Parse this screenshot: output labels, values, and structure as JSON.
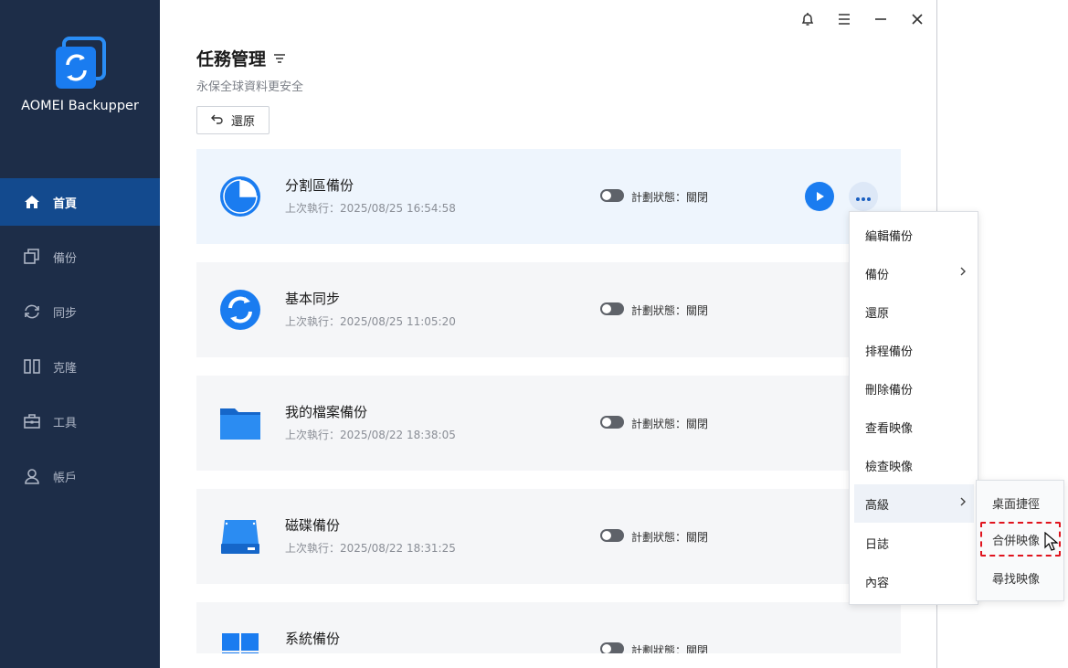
{
  "app": {
    "name": "AOMEI Backupper"
  },
  "sidebar": {
    "items": [
      {
        "label": "首頁",
        "icon": "home-icon",
        "active": true
      },
      {
        "label": "備份",
        "icon": "backup-icon",
        "active": false
      },
      {
        "label": "同步",
        "icon": "sync-icon",
        "active": false
      },
      {
        "label": "克隆",
        "icon": "clone-icon",
        "active": false
      },
      {
        "label": "工具",
        "icon": "tools-icon",
        "active": false
      },
      {
        "label": "帳戶",
        "icon": "account-icon",
        "active": false
      }
    ]
  },
  "header": {
    "title": "任務管理",
    "subtitle": "永保全球資料更安全",
    "restore_label": "還原"
  },
  "tasks": [
    {
      "name": "分割區備份",
      "last_run": "上次執行：2025/08/25 16:54:58",
      "status": "計劃狀態：關閉",
      "icon": "partition-backup-icon"
    },
    {
      "name": "基本同步",
      "last_run": "上次執行：2025/08/25 11:05:20",
      "status": "計劃狀態：關閉",
      "icon": "sync-task-icon"
    },
    {
      "name": "我的檔案備份",
      "last_run": "上次執行：2025/08/22 18:38:05",
      "status": "計劃狀態：關閉",
      "icon": "folder-icon"
    },
    {
      "name": "磁碟備份",
      "last_run": "上次執行：2025/08/22 18:31:25",
      "status": "計劃狀態：關閉",
      "icon": "disk-icon"
    },
    {
      "name": "系統備份",
      "last_run": "",
      "status": "計劃狀態：關閉",
      "icon": "windows-icon"
    }
  ],
  "context_menu": {
    "items": [
      "編輯備份",
      "備份",
      "還原",
      "排程備份",
      "刪除備份",
      "查看映像",
      "檢查映像",
      "高級",
      "日誌",
      "內容"
    ]
  },
  "submenu": {
    "items": [
      "桌面捷徑",
      "合併映像",
      "尋找映像"
    ]
  },
  "colors": {
    "sidebar_bg": "#1d2d48",
    "sidebar_active": "#134a8e",
    "accent": "#1a7cf0",
    "highlight_border": "#e0141e"
  }
}
